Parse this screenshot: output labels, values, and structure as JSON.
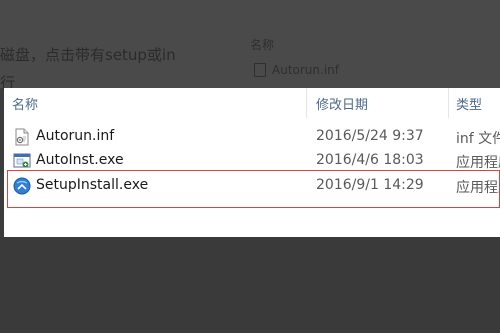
{
  "background": {
    "article_text_line1": "磁盘，点击带有setup或in",
    "article_text_line2": "行",
    "bg_column_name": "名称",
    "bg_file_name": "Autorun.inf"
  },
  "explorer": {
    "columns": [
      "名称",
      "修改日期",
      "类型"
    ],
    "files": [
      {
        "name": "Autorun.inf",
        "date": "2016/5/24 9:37",
        "type": "inf 文件",
        "icon": "inf-file-icon"
      },
      {
        "name": "AutoInst.exe",
        "date": "2016/4/6 18:03",
        "type": "应用程序",
        "icon": "exe-app-icon"
      },
      {
        "name": "SetupInstall.exe",
        "date": "2016/9/1 14:29",
        "type": "应用程序",
        "icon": "setup-installer-icon"
      }
    ]
  },
  "colors": {
    "highlight_border": "#e0413c",
    "header_text": "#4d6b8a"
  }
}
